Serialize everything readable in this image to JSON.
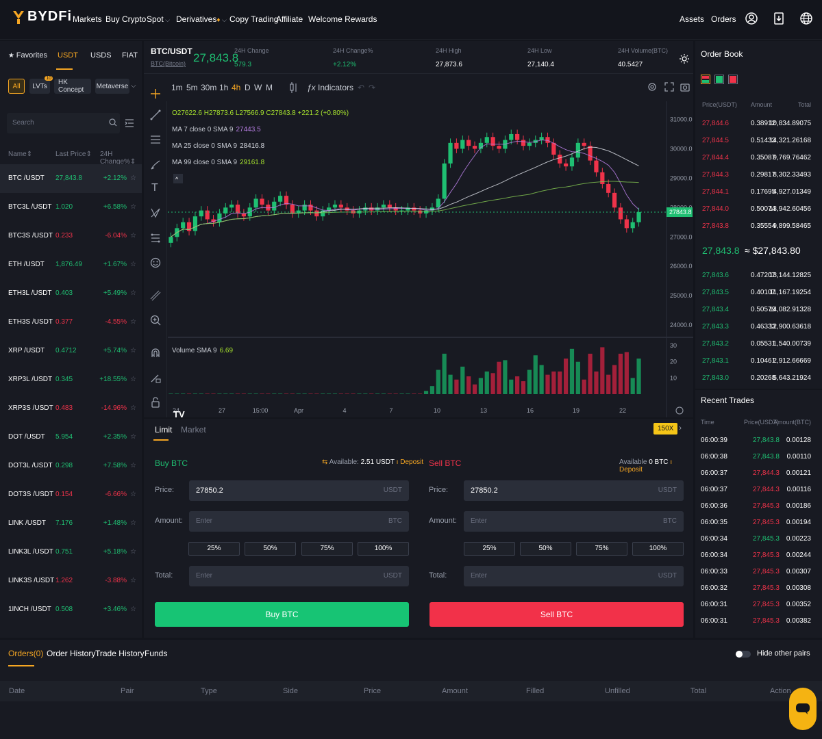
{
  "nav": {
    "logo_text": "BYDFi",
    "items": [
      "Markets",
      "Buy Crypto",
      "Spot",
      "Derivatives",
      "Copy Trading",
      "Affiliate",
      "Welcome Rewards"
    ],
    "right": [
      "Assets",
      "Orders"
    ]
  },
  "left": {
    "tabs": [
      "Favorites",
      "USDT",
      "USDS",
      "FIAT"
    ],
    "chips": [
      "All",
      "LVTs",
      "HK Concept",
      "Metaverse"
    ],
    "lvts_badge": "10",
    "search_placeholder": "Search",
    "headers": [
      "Name",
      "Last Price",
      "24H Change%"
    ],
    "pairs": [
      {
        "name": "BTC /USDT",
        "price": "27,843.8",
        "change": "+2.12%",
        "dir": "up"
      },
      {
        "name": "BTC3L /USDT",
        "price": "1.020",
        "change": "+6.58%",
        "dir": "up"
      },
      {
        "name": "BTC3S /USDT",
        "price": "0.233",
        "change": "-6.04%",
        "dir": "down"
      },
      {
        "name": "ETH /USDT",
        "price": "1,876.49",
        "change": "+1.67%",
        "dir": "up"
      },
      {
        "name": "ETH3L /USDT",
        "price": "0.403",
        "change": "+5.49%",
        "dir": "up"
      },
      {
        "name": "ETH3S /USDT",
        "price": "0.377",
        "change": "-4.55%",
        "dir": "down"
      },
      {
        "name": "XRP /USDT",
        "price": "0.4712",
        "change": "+5.74%",
        "dir": "up"
      },
      {
        "name": "XRP3L /USDT",
        "price": "0.345",
        "change": "+18.55%",
        "dir": "up"
      },
      {
        "name": "XRP3S /USDT",
        "price": "0.483",
        "change": "-14.96%",
        "dir": "down"
      },
      {
        "name": "DOT /USDT",
        "price": "5.954",
        "change": "+2.35%",
        "dir": "up"
      },
      {
        "name": "DOT3L /USDT",
        "price": "0.298",
        "change": "+7.58%",
        "dir": "up"
      },
      {
        "name": "DOT3S /USDT",
        "price": "0.154",
        "change": "-6.66%",
        "dir": "down"
      },
      {
        "name": "LINK /USDT",
        "price": "7.176",
        "change": "+1.48%",
        "dir": "up"
      },
      {
        "name": "LINK3L /USDT",
        "price": "0.751",
        "change": "+5.18%",
        "dir": "up"
      },
      {
        "name": "LINK3S /USDT",
        "price": "1.262",
        "change": "-3.88%",
        "dir": "down"
      },
      {
        "name": "1INCH /USDT",
        "price": "0.508",
        "change": "+3.46%",
        "dir": "up"
      }
    ]
  },
  "ticker": {
    "pair": "BTC/USDT",
    "sub": "BTC(Bitcoin)",
    "price": "27,843.8",
    "stats": [
      {
        "label": "24H Change",
        "value": "579.3",
        "dir": "up"
      },
      {
        "label": "24H Change%",
        "value": "+2.12%",
        "dir": "up"
      },
      {
        "label": "24H High",
        "value": "27,873.6",
        "dir": "flat"
      },
      {
        "label": "24H Low",
        "value": "27,140.4",
        "dir": "flat"
      },
      {
        "label": "24H Volume(BTC)",
        "value": "40.5427",
        "dir": "flat"
      }
    ]
  },
  "toolbar": {
    "intervals": [
      "1m",
      "5m",
      "30m",
      "1h",
      "4h",
      "D",
      "W",
      "M"
    ],
    "active_interval": "4h",
    "indicators": "Indicators"
  },
  "chart_data": {
    "type": "line",
    "ohlc_text": {
      "o": "27622.6",
      "h": "27873.6",
      "l": "27566.9",
      "c": "27843.8",
      "chg": "+221.2 (+0.80%)"
    },
    "ma_labels": [
      {
        "label": "MA 7 close 0 SMA 9",
        "value": "27443.5",
        "color": "#b57de0"
      },
      {
        "label": "MA 25 close 0 SMA 9",
        "value": "28416.8",
        "color": "#d6d9e0"
      },
      {
        "label": "MA 99 close 0 SMA 9",
        "value": "29161.8",
        "color": "#a6e22e"
      }
    ],
    "y_ticks": [
      "31000.0",
      "30000.0",
      "29000.0",
      "28000.0",
      "27000.0",
      "26000.0",
      "25000.0",
      "24000.0"
    ],
    "y_tick_values": [
      31000,
      30000,
      29000,
      28000,
      27000,
      26000,
      25000,
      24000
    ],
    "ylim": [
      23700,
      31500
    ],
    "current_price_label": "27843.8",
    "current_price": 27843.8,
    "x_ticks": [
      "24",
      "27",
      "15:00",
      "Apr",
      "4",
      "7",
      "10",
      "13",
      "16",
      "19",
      "22"
    ],
    "closes": [
      27000,
      27300,
      27500,
      27200,
      27700,
      27900,
      27600,
      27500,
      27800,
      28000,
      28100,
      27800,
      27700,
      28000,
      28300,
      28100,
      27900,
      28200,
      28400,
      28100,
      27800,
      27900,
      28100,
      27900,
      27700,
      27900,
      28000,
      28100,
      28000,
      27900,
      27800,
      27900,
      28000,
      27900,
      28000,
      28100,
      28000,
      27900,
      27900,
      28000,
      27900,
      27800,
      27900,
      28000,
      28300,
      29500,
      30200,
      30000,
      30300,
      30100,
      30000,
      30200,
      30400,
      30100,
      30000,
      30300,
      30500,
      30300,
      30100,
      30200,
      30300,
      30400,
      30200,
      29800,
      29500,
      29400,
      29700,
      30200,
      30100,
      29600,
      29200,
      28800,
      28500,
      28000,
      27600,
      27300,
      27500,
      27843.8
    ],
    "volume_label": "Volume SMA 9",
    "volume_value": "6.69",
    "volume_ticks": [
      "30",
      "20",
      "10"
    ],
    "volume_tick_values": [
      30,
      20,
      10
    ],
    "volume_ylim": [
      0,
      33
    ],
    "volumes": [
      0.3,
      0.3,
      0.3,
      0.3,
      0.3,
      0.3,
      0.3,
      0.3,
      0.3,
      0.3,
      0.3,
      0.3,
      0.3,
      0.3,
      0.3,
      0.3,
      0.3,
      0.3,
      0.3,
      0.3,
      0.3,
      0.3,
      0.3,
      0.3,
      0.3,
      0.3,
      0.3,
      0.3,
      0.3,
      0.3,
      0.3,
      0.3,
      0.3,
      0.3,
      0.3,
      0.3,
      0.3,
      0.3,
      0.3,
      0.3,
      0.3,
      0.3,
      2,
      5,
      15,
      25,
      12,
      9,
      17,
      11,
      6,
      10,
      14,
      13,
      20,
      21,
      9,
      11,
      8,
      15,
      24,
      18,
      12,
      14,
      14,
      22,
      28,
      20,
      9,
      25,
      14,
      29,
      12,
      18,
      25,
      26,
      10,
      22,
      9,
      8,
      5
    ]
  },
  "order_form": {
    "tabs": [
      "Limit",
      "Market"
    ],
    "leverage": "150X",
    "buy": {
      "title": "Buy BTC",
      "available_label": "Available:",
      "available_value": "2.51 USDT",
      "deposit": "Deposit",
      "price": "27850.2",
      "button": "Buy BTC"
    },
    "sell": {
      "title": "Sell BTC",
      "available_label": "Available",
      "available_value": "0 BTC",
      "deposit": "Deposit",
      "price": "27850.2",
      "button": "Sell BTC"
    },
    "labels": {
      "price": "Price:",
      "amount": "Amount:",
      "total": "Total:"
    },
    "placeholders": {
      "enter": "Enter"
    },
    "units": {
      "usdt": "USDT",
      "btc": "BTC"
    },
    "percents": [
      "25%",
      "50%",
      "75%",
      "100%"
    ]
  },
  "order_book": {
    "title": "Order Book",
    "headers": [
      "Price(USDT)",
      "Amount",
      "Total"
    ],
    "asks": [
      {
        "p": "27,844.6",
        "a": "0.38912",
        "t": "10,834.89075"
      },
      {
        "p": "27,844.5",
        "a": "0.51433",
        "t": "14,321.26168"
      },
      {
        "p": "27,844.4",
        "a": "0.35087",
        "t": "9,769.76462"
      },
      {
        "p": "27,844.3",
        "a": "0.29817",
        "t": "8,302.33493"
      },
      {
        "p": "27,844.1",
        "a": "0.17695",
        "t": "4,927.01349"
      },
      {
        "p": "27,844.0",
        "a": "0.50074",
        "t": "13,942.60456"
      },
      {
        "p": "27,843.8",
        "a": "0.35554",
        "t": "9,899.58465"
      }
    ],
    "mid_price": "27,843.8",
    "mid_usd": "≈ $27,843.80",
    "bids": [
      {
        "p": "27,843.6",
        "a": "0.47207",
        "t": "13,144.12825"
      },
      {
        "p": "27,843.5",
        "a": "0.40107",
        "t": "11,167.19254"
      },
      {
        "p": "27,843.4",
        "a": "0.50579",
        "t": "14,082.91328"
      },
      {
        "p": "27,843.3",
        "a": "0.46333",
        "t": "12,900.63618"
      },
      {
        "p": "27,843.2",
        "a": "0.05531",
        "t": "1,540.00739"
      },
      {
        "p": "27,843.1",
        "a": "0.10461",
        "t": "2,912.66669"
      },
      {
        "p": "27,843.0",
        "a": "0.20268",
        "t": "5,643.21924"
      }
    ]
  },
  "recent_trades": {
    "title": "Recent Trades",
    "headers": [
      "Time",
      "Price(USDT)",
      "Amount(BTC)"
    ],
    "rows": [
      {
        "t": "06:00:39",
        "p": "27,843.8",
        "a": "0.00128",
        "dir": "up"
      },
      {
        "t": "06:00:38",
        "p": "27,843.8",
        "a": "0.00110",
        "dir": "up"
      },
      {
        "t": "06:00:37",
        "p": "27,844.3",
        "a": "0.00121",
        "dir": "down"
      },
      {
        "t": "06:00:37",
        "p": "27,844.3",
        "a": "0.00116",
        "dir": "down"
      },
      {
        "t": "06:00:36",
        "p": "27,845.3",
        "a": "0.00186",
        "dir": "down"
      },
      {
        "t": "06:00:35",
        "p": "27,845.3",
        "a": "0.00194",
        "dir": "down"
      },
      {
        "t": "06:00:34",
        "p": "27,845.3",
        "a": "0.00223",
        "dir": "up"
      },
      {
        "t": "06:00:34",
        "p": "27,845.3",
        "a": "0.00244",
        "dir": "down"
      },
      {
        "t": "06:00:33",
        "p": "27,845.3",
        "a": "0.00307",
        "dir": "down"
      },
      {
        "t": "06:00:32",
        "p": "27,845.3",
        "a": "0.00308",
        "dir": "down"
      },
      {
        "t": "06:00:31",
        "p": "27,845.3",
        "a": "0.00352",
        "dir": "down"
      },
      {
        "t": "06:00:31",
        "p": "27,845.3",
        "a": "0.00382",
        "dir": "down"
      }
    ]
  },
  "bottom": {
    "tabs": [
      "Orders(0)",
      "Order History",
      "Trade History",
      "Funds"
    ],
    "hide_pairs": "Hide other pairs",
    "columns": [
      "Date",
      "Pair",
      "Type",
      "Side",
      "Price",
      "Amount",
      "Filled",
      "Unfilled",
      "Total",
      "Action"
    ]
  },
  "colors": {
    "up": "#1fbf72",
    "down": "#f0334a",
    "accent": "#f5a623"
  }
}
